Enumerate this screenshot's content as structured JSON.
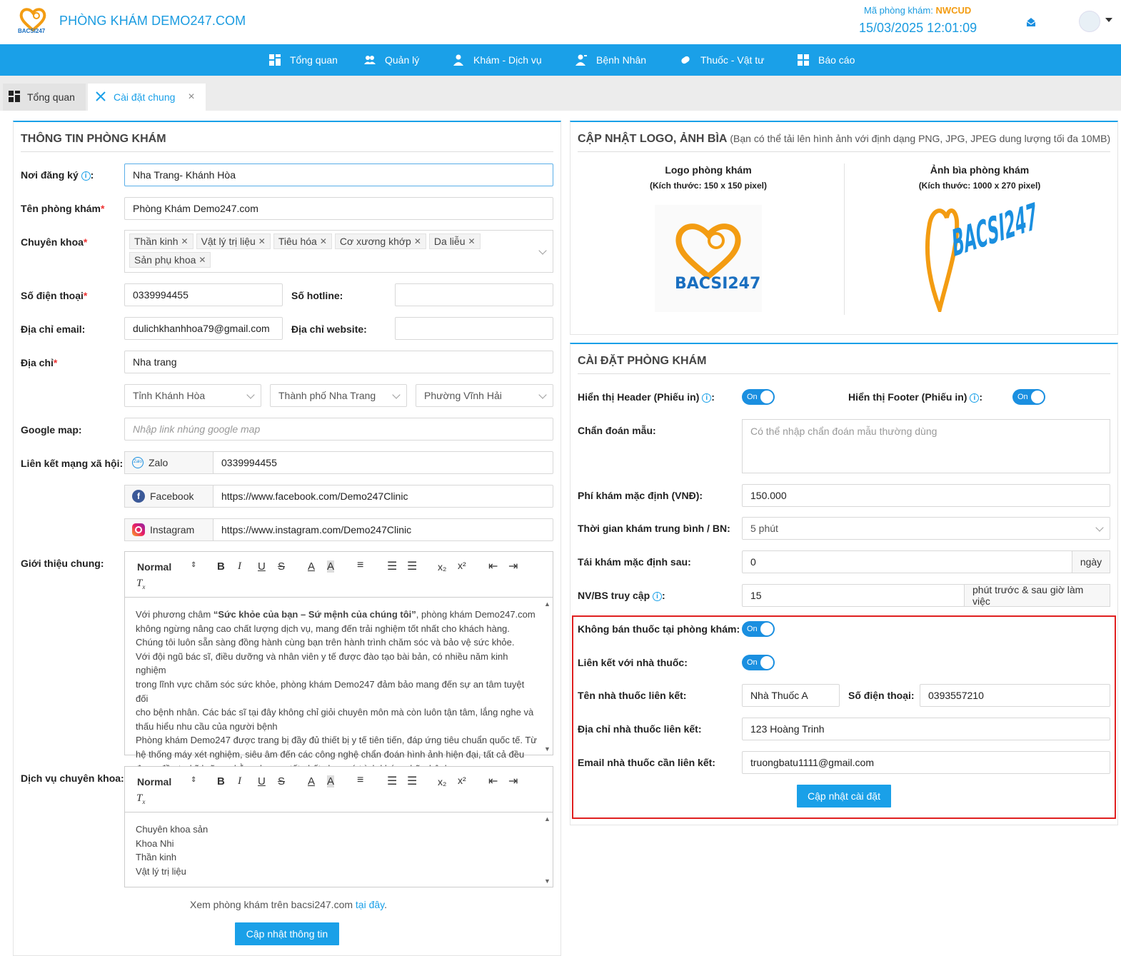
{
  "header": {
    "brand": "PHÒNG KHÁM DEMO247.COM",
    "logo_text": "BACSI247",
    "code_label": "Mã phòng khám:",
    "code_value": "NWCUD",
    "datetime": "15/03/2025 12:01:09"
  },
  "nav": [
    {
      "label": "Tổng quan",
      "icon": "dashboard-icon"
    },
    {
      "label": "Quản lý",
      "icon": "users-icon"
    },
    {
      "label": "Khám - Dịch vụ",
      "icon": "doctor-icon"
    },
    {
      "label": "Bệnh Nhân",
      "icon": "patient-icon"
    },
    {
      "label": "Thuốc - Vật tư",
      "icon": "pill-icon"
    },
    {
      "label": "Báo cáo",
      "icon": "report-icon"
    }
  ],
  "tabs": {
    "t1": "Tổng quan",
    "t2": "Cài đặt chung",
    "close": "×"
  },
  "left": {
    "title": "THÔNG TIN PHÒNG KHÁM",
    "noi_dang_ky_label": "Nơi đăng ký",
    "noi_dang_ky_value": "Nha Trang- Khánh Hòa",
    "ten_label": "Tên phòng khám",
    "ten_value": "Phòng Khám Demo247.com",
    "chuyen_khoa_label": "Chuyên khoa",
    "chuyen_khoa_tags": [
      "Thần kinh",
      "Vật lý trị liệu",
      "Tiêu hóa",
      "Cơ xương khớp",
      "Da liễu",
      "Sản phụ khoa"
    ],
    "sdt_label": "Số điện thoại",
    "sdt_value": "0339994455",
    "hotline_label": "Số hotline",
    "hotline_value": "",
    "email_label": "Địa chỉ email",
    "email_value": "dulichkhanhhoa79@gmail.com",
    "website_label": "Địa chỉ website",
    "website_value": "",
    "dia_chi_label": "Địa chỉ",
    "dia_chi_value": "Nha trang",
    "tinh": "Tỉnh Khánh Hòa",
    "thanh_pho": "Thành phố Nha Trang",
    "phuong": "Phường Vĩnh Hải",
    "gmap_label": "Google map",
    "gmap_placeholder": "Nhập link nhúng google map",
    "social_label": "Liên kết mạng xã hội",
    "zalo_label": "Zalo",
    "zalo_value": "0339994455",
    "fb_label": "Facebook",
    "fb_value": "https://www.facebook.com/Demo247Clinic",
    "ig_label": "Instagram",
    "ig_value": "https://www.instagram.com/Demo247Clinic",
    "gioi_thieu_label": "Giới thiệu chung",
    "toolbar": {
      "normal": "Normal",
      "b": "B",
      "i": "I",
      "u": "U",
      "s": "S",
      "a": "A"
    },
    "intro_lines": [
      "Với phương châm “Sức khỏe của bạn – Sứ mệnh của chúng tôi”, phòng khám Demo247.com",
      "không ngừng nâng cao chất lượng dịch vụ, mang đến trải nghiệm tốt nhất cho khách hàng.",
      "Chúng tôi luôn sẵn sàng đồng hành cùng bạn trên hành trình chăm sóc và bảo vệ sức khỏe.",
      "Với đội ngũ bác sĩ, điều dưỡng và nhân viên y tế được đào tạo bài bản, có nhiều năm kinh nghiệm",
      "trong lĩnh vực chăm sóc sức khỏe, phòng khám Demo247 đảm bảo mang đến sự an tâm tuyệt đối",
      "cho bệnh nhân. Các bác sĩ tại đây không chỉ giỏi chuyên môn mà còn luôn tận tâm, lắng nghe và",
      "thấu hiểu nhu cầu của người bệnh",
      "Phòng khám Demo247 được trang bị đầy đủ thiết bị y tế tiên tiến, đáp ứng tiêu chuẩn quốc tế. Từ",
      "hệ thống máy xét nghiệm, siêu âm đến các công nghệ chẩn đoán hình ảnh hiện đại, tất cả đều",
      "được đầu tư kỹ lưỡng nhằm phục vụ tốt nhất cho quá trình khám chữa bệnh"
    ],
    "dich_vu_label": "Dịch vụ chuyên khoa",
    "dich_vu_lines": [
      "Chuyên khoa sản",
      "Khoa Nhi",
      "Thần kinh",
      "Vật lý trị liệu"
    ],
    "view_text": "Xem phòng khám trên bacsi247.com ",
    "view_link": "tại đây",
    "update_btn": "Cập nhật thông tin"
  },
  "logo_panel": {
    "title": "CẬP NHẬT LOGO, ẢNH BÌA",
    "note": "(Bạn có thể tải lên hình ảnh với định dạng PNG, JPG, JPEG dung lượng tối đa 10MB)",
    "logo_title": "Logo phòng khám",
    "logo_size": "(Kích thước: 150 x 150 pixel)",
    "cover_title": "Ảnh bìa phòng khám",
    "cover_size": "(Kích thước: 1000 x 270 pixel)",
    "logo_img_text": "BACSI247",
    "cover_img_text": "BACSI247"
  },
  "settings": {
    "title": "CÀI ĐẶT PHÒNG KHÁM",
    "header_label": "Hiển thị Header (Phiếu in)",
    "footer_label": "Hiển thị Footer (Phiếu in)",
    "on": "On",
    "chan_doan_label": "Chẩn đoán mẫu",
    "chan_doan_placeholder": "Có thể nhập chẩn đoán mẫu thường dùng",
    "phi_label": "Phí khám mặc định (VNĐ)",
    "phi_value": "150.000",
    "thoi_gian_label": "Thời gian khám trung bình / BN",
    "thoi_gian_value": "5 phút",
    "tai_kham_label": "Tái khám mặc định sau",
    "tai_kham_value": "0",
    "tai_kham_unit": "ngày",
    "nvbs_label": "NV/BS truy cập",
    "nvbs_value": "15",
    "nvbs_unit": "phút trước & sau giờ làm việc",
    "khong_ban_label": "Không bán thuốc tại phòng khám",
    "lien_ket_label": "Liên kết với nhà thuốc",
    "ten_nt_label": "Tên nhà thuốc liên kết",
    "ten_nt_value": "Nhà Thuốc A",
    "sdt_nt_label": "Số điện thoại",
    "sdt_nt_value": "0393557210",
    "dc_nt_label": "Địa chỉ nhà thuốc liên kết",
    "dc_nt_value": "123 Hoàng Trinh",
    "email_nt_label": "Email nhà thuốc cần liên kết",
    "email_nt_value": "truongbatu1111@gmail.com",
    "update_btn": "Cập nhật cài đặt",
    "highlight_color": "#e02020"
  }
}
